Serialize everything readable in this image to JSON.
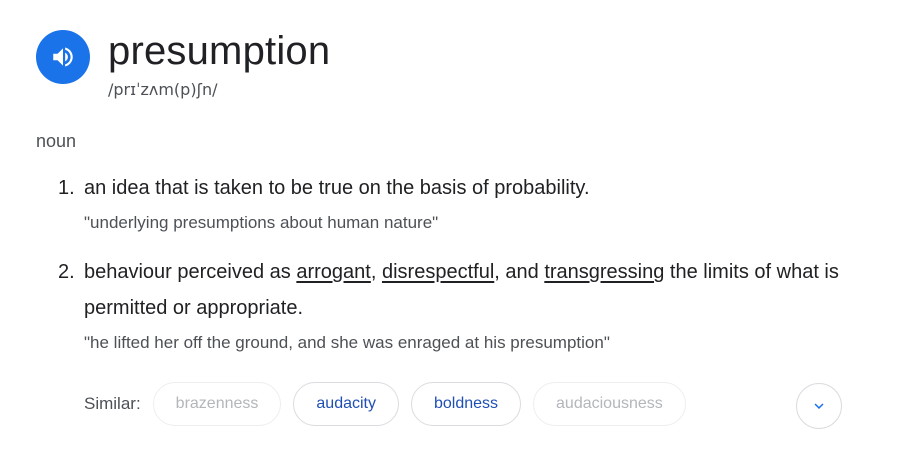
{
  "entry": {
    "word": "presumption",
    "phonetic": "/prɪˈzʌm(p)ʃn/",
    "part_of_speech": "noun"
  },
  "definitions": [
    {
      "number": "1.",
      "text_parts": [
        "an idea that is taken to be true on the basis of probability."
      ],
      "example": "\"underlying presumptions about human nature\""
    },
    {
      "number": "2.",
      "text_parts": [
        "behaviour perceived as ",
        "arrogant",
        ", ",
        "disrespectful",
        ", and ",
        "transgressing",
        " the limits of what is permitted or appropriate."
      ],
      "example": "\"he lifted her off the ground, and she was enraged at his presumption\""
    }
  ],
  "similar": {
    "label": "Similar:",
    "chips": [
      {
        "label": "brazenness",
        "active": false
      },
      {
        "label": "audacity",
        "active": true
      },
      {
        "label": "boldness",
        "active": true
      },
      {
        "label": "audaciousness",
        "active": false
      }
    ]
  },
  "icons": {
    "speaker": "speaker-icon",
    "expand": "chevron-down-icon"
  },
  "colors": {
    "accent": "#1a73e8",
    "link_chip": "#1f4fb3",
    "muted_chip": "#b3b6ba"
  }
}
